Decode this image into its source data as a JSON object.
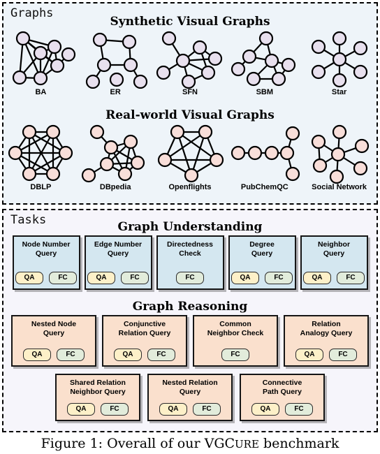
{
  "figure": {
    "caption_prefix": "Figure 1: Overall of our ",
    "caption_name": "VGC",
    "caption_name_sc": "URE",
    "caption_suffix": " benchmark"
  },
  "graphs_panel": {
    "label": "Graphs",
    "synthetic": {
      "title": "Synthetic Visual Graphs",
      "node_color": "#e8e0ee",
      "items": [
        {
          "label": "BA"
        },
        {
          "label": "ER"
        },
        {
          "label": "SFN"
        },
        {
          "label": "SBM"
        },
        {
          "label": "Star"
        }
      ]
    },
    "realworld": {
      "title": "Real-world Visual Graphs",
      "node_color": "#f8ded9",
      "items": [
        {
          "label": "DBLP"
        },
        {
          "label": "DBpedia"
        },
        {
          "label": "Openflights"
        },
        {
          "label": "PubChemQC"
        },
        {
          "label": "Social Network"
        }
      ]
    }
  },
  "tasks_panel": {
    "label": "Tasks",
    "understanding": {
      "title": "Graph Understanding",
      "card_color": "#d4e7f0",
      "cards": [
        {
          "title": "Node Number\nQuery",
          "badges": [
            "QA",
            "FC"
          ]
        },
        {
          "title": "Edge Number\nQuery",
          "badges": [
            "QA",
            "FC"
          ]
        },
        {
          "title": "Directedness\nCheck",
          "badges": [
            "FC"
          ]
        },
        {
          "title": "Degree\nQuery",
          "badges": [
            "QA",
            "FC"
          ]
        },
        {
          "title": "Neighbor\nQuery",
          "badges": [
            "QA",
            "FC"
          ]
        }
      ]
    },
    "reasoning": {
      "title": "Graph Reasoning",
      "card_color": "#fae0cd",
      "row1": [
        {
          "title": "Nested Node\nQuery",
          "badges": [
            "QA",
            "FC"
          ]
        },
        {
          "title": "Conjunctive\nRelation Query",
          "badges": [
            "QA",
            "FC"
          ]
        },
        {
          "title": "Common\nNeighbor Check",
          "badges": [
            "FC"
          ]
        },
        {
          "title": "Relation\nAnalogy Query",
          "badges": [
            "QA",
            "FC"
          ]
        }
      ],
      "row2": [
        {
          "title": "Shared Relation\nNeighbor Query",
          "badges": [
            "QA",
            "FC"
          ]
        },
        {
          "title": "Nested Relation\nQuery",
          "badges": [
            "QA",
            "FC"
          ]
        },
        {
          "title": "Connective\nPath Query",
          "badges": [
            "QA",
            "FC"
          ]
        }
      ]
    }
  },
  "badge_colors": {
    "QA": "#fdf0c8",
    "FC": "#e2ecdb"
  }
}
